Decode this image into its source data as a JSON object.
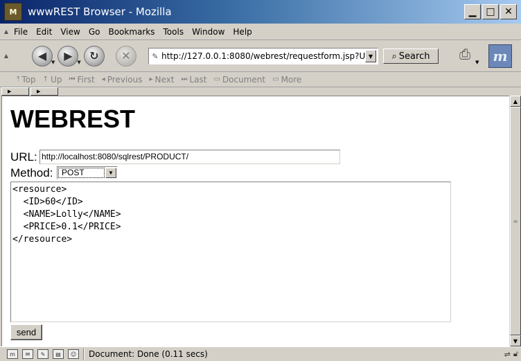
{
  "window": {
    "title": "wwwREST Browser - Mozilla",
    "app_icon_text": "M"
  },
  "menu": {
    "items": [
      "File",
      "Edit",
      "View",
      "Go",
      "Bookmarks",
      "Tools",
      "Window",
      "Help"
    ]
  },
  "nav": {
    "url": "http://127.0.0.1:8080/webrest/requestform.jsp?U",
    "search_label": "Search",
    "logo_text": "m"
  },
  "sitebar": {
    "items": [
      "Top",
      "Up",
      "First",
      "Previous",
      "Next",
      "Last",
      "Document",
      "More"
    ]
  },
  "page": {
    "title": "WEBREST",
    "url_label": "URL:",
    "url_value": "http://localhost:8080/sqlrest/PRODUCT/",
    "method_label": "Method:",
    "method_value": "POST",
    "body": "<resource>\n  <ID>60</ID>\n  <NAME>Lolly</NAME>\n  <PRICE>0.1</PRICE>\n</resource>",
    "send_label": "send"
  },
  "status": {
    "text": "Document: Done (0.11 secs)"
  }
}
